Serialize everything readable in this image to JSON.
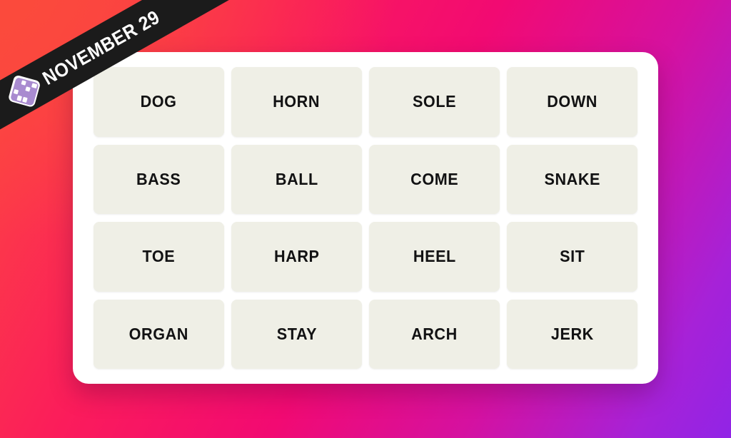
{
  "ribbon": {
    "date_label": "NOVEMBER 29",
    "logo_icon": "connections-grid-icon",
    "background_color": "#1B1B1B",
    "text_color": "#FFFFFF",
    "logo_color": "#A98BD0"
  },
  "background": {
    "gradient_stops": [
      "#FC4A3F",
      "#FB1C5B",
      "#F20A72",
      "#D511A0",
      "#A622D8",
      "#9124E6"
    ]
  },
  "card": {
    "background_color": "#FFFFFF",
    "tile_color": "#EFEFE6",
    "tile_text_color": "#121213"
  },
  "grid": {
    "columns": 4,
    "rows": 4,
    "tiles": [
      {
        "label": "DOG"
      },
      {
        "label": "HORN"
      },
      {
        "label": "SOLE"
      },
      {
        "label": "DOWN"
      },
      {
        "label": "BASS"
      },
      {
        "label": "BALL"
      },
      {
        "label": "COME"
      },
      {
        "label": "SNAKE"
      },
      {
        "label": "TOE"
      },
      {
        "label": "HARP"
      },
      {
        "label": "HEEL"
      },
      {
        "label": "SIT"
      },
      {
        "label": "ORGAN"
      },
      {
        "label": "STAY"
      },
      {
        "label": "ARCH"
      },
      {
        "label": "JERK"
      }
    ]
  },
  "logo_pattern": [
    [
      0,
      1,
      0,
      1
    ],
    [
      0,
      0,
      1,
      0
    ],
    [
      1,
      0,
      0,
      0
    ],
    [
      0,
      1,
      1,
      0
    ]
  ]
}
